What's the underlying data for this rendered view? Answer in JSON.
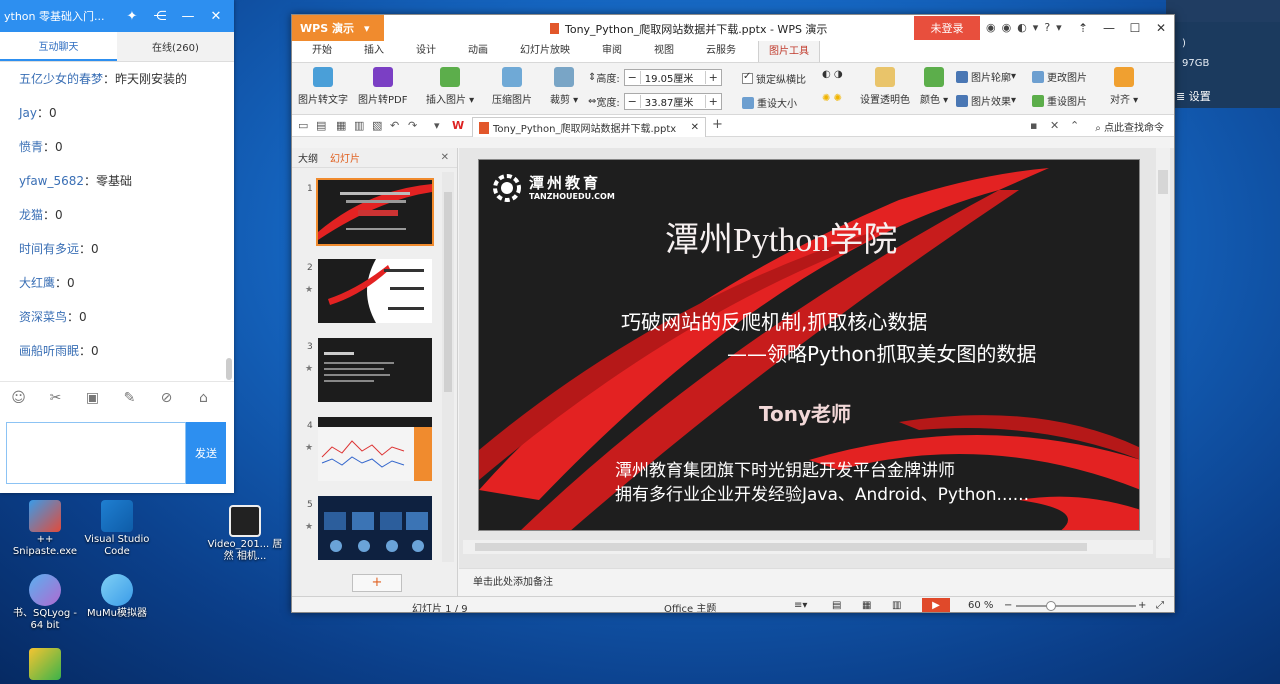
{
  "chat": {
    "title": "ython 零基础入门...",
    "tabs": [
      "互动聊天",
      "在线(260)"
    ],
    "messages": [
      {
        "user": "五亿少女的春梦",
        "text": "：昨天刚安装的"
      },
      {
        "user": "Jay",
        "text": "：0"
      },
      {
        "user": "愤青",
        "text": "：0"
      },
      {
        "user": "yfaw_5682",
        "text": "：零基础"
      },
      {
        "user": "龙猫",
        "text": "：0"
      },
      {
        "user": "时间有多远",
        "text": "：0"
      },
      {
        "user": "大红鹰",
        "text": "：0"
      },
      {
        "user": "资深菜鸟",
        "text": "：0"
      },
      {
        "user": "画船听雨眠",
        "text": "：0"
      }
    ],
    "send_label": "发送"
  },
  "desktop": {
    "icons": [
      {
        "label": "++ Snipaste.exe"
      },
      {
        "label": "Visual Studio Code"
      },
      {
        "label": "Video_201... 居然 相机..."
      },
      {
        "label": "书、SQLyog - 64 bit"
      },
      {
        "label": "MuMu模拟器"
      }
    ]
  },
  "bg_window": {
    "line1": ")",
    "line2": "97GB",
    "settings": "设置"
  },
  "wps": {
    "app_label": "WPS 演示",
    "doc_title": "Tony_Python_爬取网站数据并下载.pptx - WPS 演示",
    "login_label": "未登录",
    "menu": [
      "开始",
      "插入",
      "设计",
      "动画",
      "幻灯片放映",
      "审阅",
      "视图",
      "云服务",
      "图片工具"
    ],
    "ribbon": {
      "to_text": "图片转文字",
      "to_pdf": "图片转PDF",
      "insert_pic": "插入图片",
      "compress": "压缩图片",
      "crop": "裁剪",
      "height_label": "高度:",
      "height_value": "19.05厘米",
      "width_label": "宽度:",
      "width_value": "33.87厘米",
      "lock_ratio": "锁定纵横比",
      "reset_size": "重设大小",
      "set_transparent": "设置透明色",
      "color": "颜色",
      "outline": "图片轮廓",
      "effect": "图片效果",
      "change_pic": "更改图片",
      "reset_pic": "重设图片",
      "align": "对齐"
    },
    "doc_tab": "Tony_Python_爬取网站数据并下载.pptx",
    "find_label": "点此查找命令",
    "panel_tabs": [
      "大纲",
      "幻灯片"
    ],
    "slides": [
      {
        "num": "1",
        "selected": true
      },
      {
        "num": "2"
      },
      {
        "num": "3"
      },
      {
        "num": "4"
      },
      {
        "num": "5"
      }
    ],
    "slide": {
      "brand": "潭州教育",
      "brand_sub": "TANZHOUEDU.COM",
      "title": "潭州Python学院",
      "subtitle1": "巧破网站的反爬机制,抓取核心数据",
      "subtitle2": "——领略Python抓取美女图的数据",
      "teacher": "Tony老师",
      "desc1": "潭州教育集团旗下时光钥匙开发平台金牌讲师",
      "desc2": "拥有多行业企业开发经验Java、Android、Python......"
    },
    "notes_placeholder": "单击此处添加备注",
    "status": {
      "slide_count": "幻灯片 1 / 9",
      "theme": "Office 主题",
      "zoom": "60 %"
    },
    "colors": {
      "accent_orange": "#f08b2e",
      "login_red": "#e84f3d",
      "chat_blue": "#2d8ff0",
      "slide_red": "#e32222"
    }
  }
}
